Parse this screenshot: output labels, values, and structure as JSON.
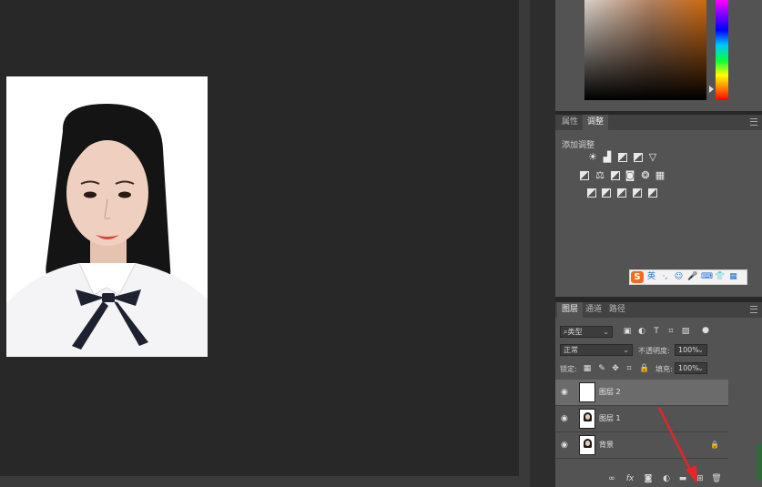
{
  "adjustments_panel": {
    "tabs": [
      "属性",
      "调整"
    ],
    "active_tab": "调整",
    "hint": "添加调整"
  },
  "ime_toolbar": {
    "logo": "S",
    "items": [
      "英",
      "·,",
      "☺",
      "🎤",
      "⌨",
      "👕",
      "▦"
    ]
  },
  "layers_panel": {
    "tabs": [
      "图层",
      "通道",
      "路径"
    ],
    "active_tab": "图层",
    "filter_kind": "类型",
    "blend_mode": "正常",
    "opacity_label": "不透明度:",
    "opacity_value": "100%",
    "lock_label": "锁定:",
    "fill_label": "填充:",
    "fill_value": "100%",
    "layers": [
      {
        "name": "图层 2",
        "selected": true,
        "thumbnail": "blank"
      },
      {
        "name": "图层 1",
        "selected": false,
        "thumbnail": "portrait"
      },
      {
        "name": "背景",
        "selected": false,
        "thumbnail": "portrait",
        "locked": true
      }
    ],
    "bottom_tools": [
      "link-icon",
      "fx-icon",
      "mask-icon",
      "adjustment-icon",
      "folder-icon",
      "new-layer-icon",
      "trash-icon"
    ],
    "fx_label": "fx"
  },
  "colors": {
    "accent_arrow": "#e8232a",
    "panel_bg": "#535353",
    "canvas_bg": "#282828"
  }
}
